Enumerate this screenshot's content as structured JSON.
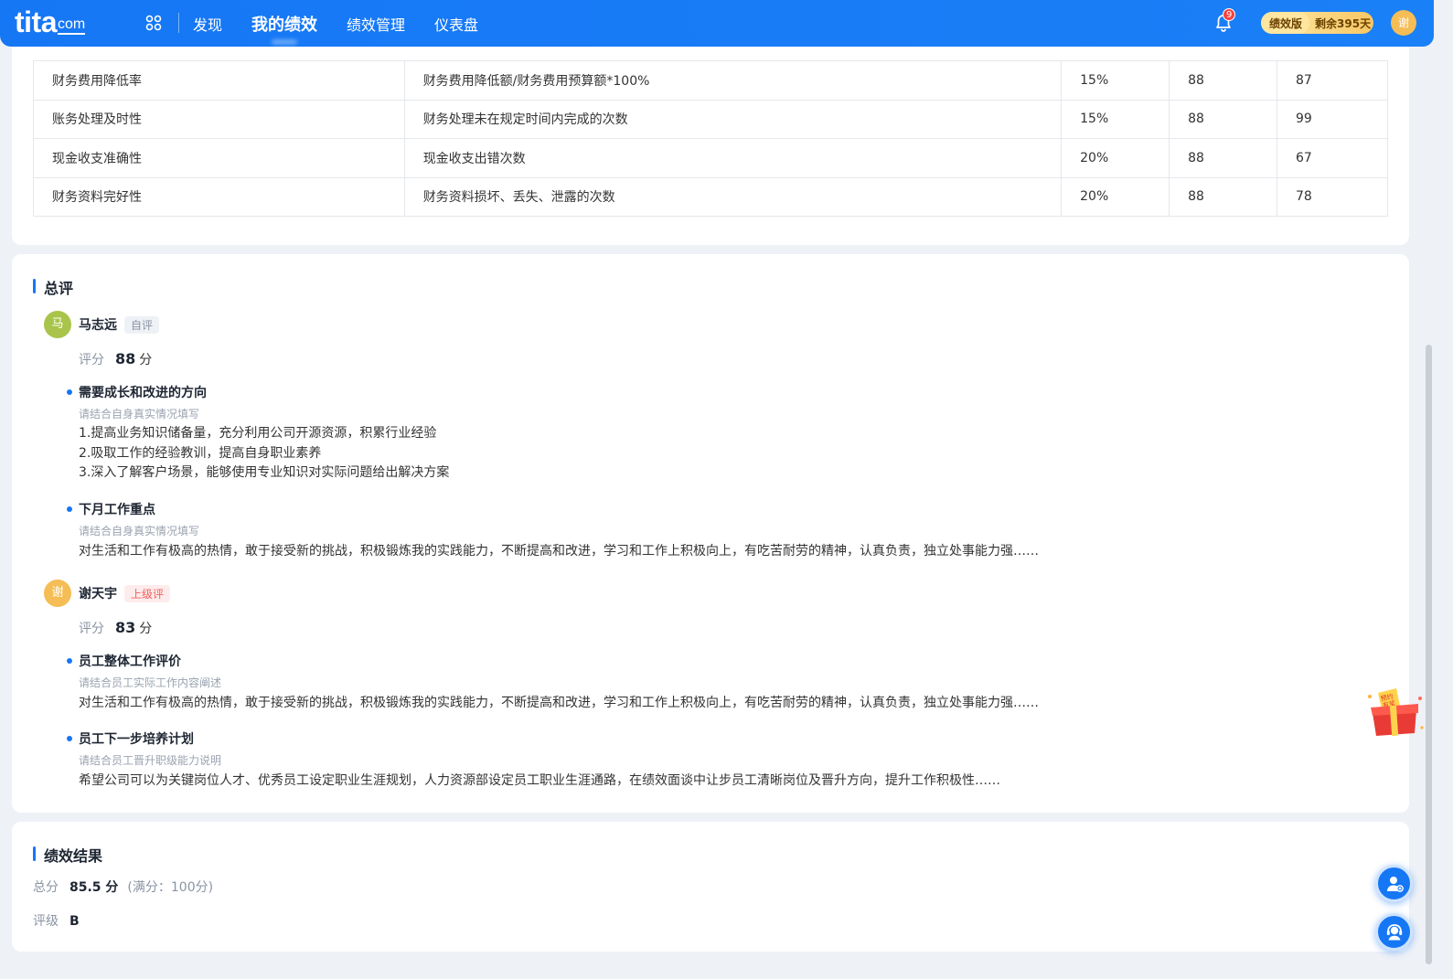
{
  "nav": {
    "logo_word": "tita",
    "logo_suffix": "com",
    "items": [
      "发现",
      "我的绩效",
      "绩效管理",
      "仪表盘"
    ],
    "notification_count": "9",
    "version_label": "绩效版",
    "remaining_label": "剩余395天",
    "user_initial": "谢"
  },
  "kpi_table": {
    "rows": [
      {
        "name": "财务费用降低率",
        "formula": "财务费用降低额/财务费用预算额*100%",
        "weight": "15%",
        "target": "88",
        "score": "87"
      },
      {
        "name": "账务处理及时性",
        "formula": "财务处理未在规定时间内完成的次数",
        "weight": "15%",
        "target": "88",
        "score": "99"
      },
      {
        "name": "现金收支准确性",
        "formula": "现金收支出错次数",
        "weight": "20%",
        "target": "88",
        "score": "67"
      },
      {
        "name": "财务资料完好性",
        "formula": "财务资料损坏、丢失、泄露的次数",
        "weight": "20%",
        "target": "88",
        "score": "78"
      }
    ]
  },
  "review": {
    "title": "总评",
    "self": {
      "initial": "马",
      "name": "马志远",
      "tag": "自评",
      "score_label": "评分",
      "score": "88",
      "score_unit": "分",
      "q1_title": "需要成长和改进的方向",
      "q1_hint": "请结合自身真实情况填写",
      "q1_lines": [
        "1.提高业务知识储备量，充分利用公司开源资源，积累行业经验",
        "2.吸取工作的经验教训，提高自身职业素养",
        "3.深入了解客户场景，能够使用专业知识对实际问题给出解决方案"
      ],
      "q2_title": "下月工作重点",
      "q2_hint": "请结合自身真实情况填写",
      "q2_text": "对生活和工作有极高的热情，敢于接受新的挑战，积极锻炼我的实践能力，不断提高和改进，学习和工作上积极向上，有吃苦耐劳的精神，认真负责，独立处事能力强……"
    },
    "superior": {
      "initial": "谢",
      "name": "谢天宇",
      "tag": "上级评",
      "score_label": "评分",
      "score": "83",
      "score_unit": "分",
      "q1_title": "员工整体工作评价",
      "q1_hint": "请结合员工实际工作内容阐述",
      "q1_text": "对生活和工作有极高的热情，敢于接受新的挑战，积极锻炼我的实践能力，不断提高和改进，学习和工作上积极向上，有吃苦耐劳的精神，认真负责，独立处事能力强……",
      "q2_title": "员工下一步培养计划",
      "q2_hint": "请结合员工晋升职级能力说明",
      "q2_text": "希望公司可以为关键岗位人才、优秀员工设定职业生涯规划，人力资源部设定员工职业生涯通路，在绩效面谈中让步员工清晰岗位及晋升方向，提升工作积极性……"
    }
  },
  "result": {
    "title": "绩效结果",
    "total_label": "总分",
    "total_value": "85.5 分",
    "total_sub": "(满分：100分)",
    "grade_label": "评级",
    "grade_value": "B"
  },
  "promo_text": "预约有奖",
  "colors": {
    "primary": "#1677f5",
    "self_avatar": "#a9c44a",
    "superior_avatar": "#f4bd55"
  }
}
